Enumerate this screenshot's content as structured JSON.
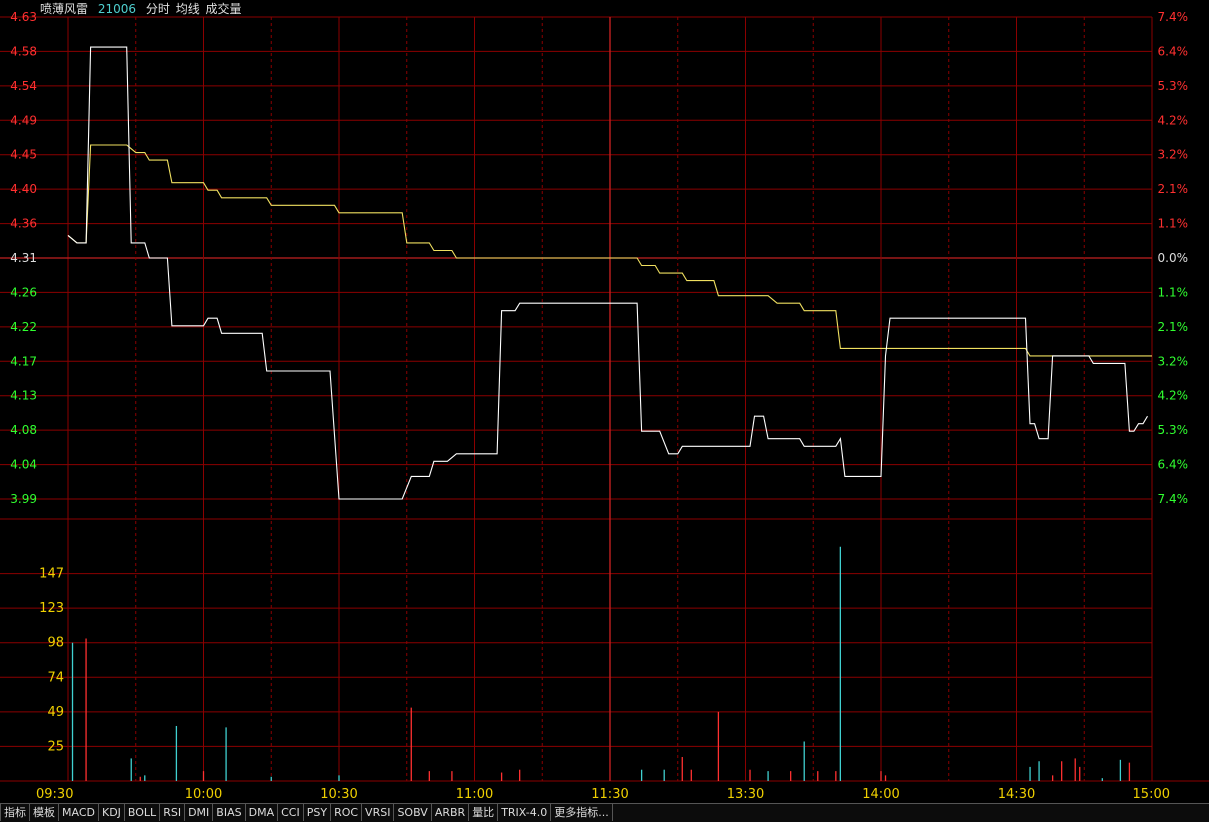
{
  "header": {
    "stock_name": "喷薄风雷",
    "stock_code": "21006",
    "items": [
      "分时",
      "均线",
      "成交量"
    ]
  },
  "tabs": [
    "指标",
    "模板",
    "MACD",
    "KDJ",
    "BOLL",
    "RSI",
    "DMI",
    "BIAS",
    "DMA",
    "CCI",
    "PSY",
    "ROC",
    "VRSI",
    "SOBV",
    "ARBR",
    "量比",
    "TRIX-4.0",
    "更多指标..."
  ],
  "colors": {
    "grid": "#8b0000",
    "up": "#ff3030",
    "down": "#30ff30",
    "price_line": "#ffffff",
    "avg_line": "#f0e060",
    "vol_up": "#ff3030",
    "vol_down": "#40d0d0",
    "vol_axis": "#f0d000"
  },
  "chart_data": {
    "type": "line",
    "title": "",
    "prev_close": 4.31,
    "price_ticks": [
      "4.63",
      "4.58",
      "4.54",
      "4.49",
      "4.45",
      "4.40",
      "4.36",
      "4.31",
      "4.26",
      "4.22",
      "4.17",
      "4.13",
      "4.08",
      "4.04",
      "3.99"
    ],
    "pct_ticks": [
      "7.4%",
      "6.4%",
      "5.3%",
      "4.2%",
      "3.2%",
      "2.1%",
      "1.1%",
      "0.0%",
      "1.1%",
      "2.1%",
      "3.2%",
      "4.2%",
      "5.3%",
      "6.4%",
      "7.4%"
    ],
    "volume_ticks": [
      "147",
      "123",
      "98",
      "74",
      "49",
      "25"
    ],
    "ylim_price": [
      3.99,
      4.63
    ],
    "ylim_volume": [
      0,
      171.5
    ],
    "time_labels": [
      "09:30",
      "10:00",
      "10:30",
      "11:00",
      "11:30",
      "13:30",
      "14:00",
      "14:30",
      "15:00"
    ],
    "session_minutes": 240,
    "series": [
      {
        "name": "",
        "points": [
          [
            0,
            4.34
          ],
          [
            2,
            4.33
          ],
          [
            4,
            4.33
          ],
          [
            5,
            4.59
          ],
          [
            13,
            4.59
          ],
          [
            14,
            4.33
          ],
          [
            17,
            4.33
          ],
          [
            18,
            4.31
          ],
          [
            22,
            4.31
          ],
          [
            23,
            4.22
          ],
          [
            30,
            4.22
          ],
          [
            31,
            4.23
          ],
          [
            33,
            4.23
          ],
          [
            34,
            4.21
          ],
          [
            43,
            4.21
          ],
          [
            44,
            4.16
          ],
          [
            58,
            4.16
          ],
          [
            60,
            3.99
          ],
          [
            74,
            3.99
          ],
          [
            76,
            4.02
          ],
          [
            80,
            4.02
          ],
          [
            81,
            4.04
          ],
          [
            84,
            4.04
          ],
          [
            86,
            4.05
          ],
          [
            95,
            4.05
          ],
          [
            96,
            4.24
          ],
          [
            99,
            4.24
          ],
          [
            100,
            4.25
          ],
          [
            126,
            4.25
          ],
          [
            127,
            4.08
          ],
          [
            131,
            4.08
          ],
          [
            133,
            4.05
          ],
          [
            135,
            4.05
          ],
          [
            136,
            4.06
          ],
          [
            151,
            4.06
          ],
          [
            152,
            4.1
          ],
          [
            154,
            4.1
          ],
          [
            155,
            4.07
          ],
          [
            162,
            4.07
          ],
          [
            163,
            4.06
          ],
          [
            170,
            4.06
          ],
          [
            171,
            4.07
          ],
          [
            172,
            4.02
          ],
          [
            180,
            4.02
          ],
          [
            181,
            4.18
          ],
          [
            182,
            4.23
          ],
          [
            212,
            4.23
          ],
          [
            213,
            4.09
          ],
          [
            214,
            4.09
          ],
          [
            215,
            4.07
          ],
          [
            217,
            4.07
          ],
          [
            218,
            4.18
          ],
          [
            226,
            4.18
          ],
          [
            227,
            4.17
          ],
          [
            234,
            4.17
          ],
          [
            235,
            4.08
          ],
          [
            236,
            4.08
          ],
          [
            237,
            4.09
          ],
          [
            238,
            4.09
          ],
          [
            239,
            4.1
          ]
        ]
      },
      {
        "name": "",
        "points": [
          [
            0,
            4.34
          ],
          [
            2,
            4.33
          ],
          [
            4,
            4.33
          ],
          [
            5,
            4.46
          ],
          [
            13,
            4.46
          ],
          [
            15,
            4.45
          ],
          [
            17,
            4.45
          ],
          [
            18,
            4.44
          ],
          [
            22,
            4.44
          ],
          [
            23,
            4.41
          ],
          [
            30,
            4.41
          ],
          [
            31,
            4.4
          ],
          [
            33,
            4.4
          ],
          [
            34,
            4.39
          ],
          [
            44,
            4.39
          ],
          [
            45,
            4.38
          ],
          [
            59,
            4.38
          ],
          [
            60,
            4.37
          ],
          [
            74,
            4.37
          ],
          [
            75,
            4.33
          ],
          [
            80,
            4.33
          ],
          [
            81,
            4.32
          ],
          [
            85,
            4.32
          ],
          [
            86,
            4.31
          ],
          [
            126,
            4.31
          ],
          [
            127,
            4.3
          ],
          [
            130,
            4.3
          ],
          [
            131,
            4.29
          ],
          [
            136,
            4.29
          ],
          [
            137,
            4.28
          ],
          [
            143,
            4.28
          ],
          [
            144,
            4.26
          ],
          [
            155,
            4.26
          ],
          [
            157,
            4.25
          ],
          [
            162,
            4.25
          ],
          [
            163,
            4.24
          ],
          [
            170,
            4.24
          ],
          [
            171,
            4.19
          ],
          [
            212,
            4.19
          ],
          [
            213,
            4.18
          ],
          [
            236,
            4.18
          ],
          [
            240,
            4.18
          ]
        ]
      }
    ],
    "volume_bars": [
      [
        1,
        98,
        "down"
      ],
      [
        4,
        101,
        "up"
      ],
      [
        14,
        16,
        "down"
      ],
      [
        16,
        3,
        "up"
      ],
      [
        17,
        4,
        "down"
      ],
      [
        24,
        39,
        "down"
      ],
      [
        30,
        7,
        "up"
      ],
      [
        35,
        38,
        "down"
      ],
      [
        45,
        3,
        "down"
      ],
      [
        60,
        4,
        "down"
      ],
      [
        76,
        52,
        "up"
      ],
      [
        80,
        7,
        "up"
      ],
      [
        85,
        7,
        "up"
      ],
      [
        96,
        6,
        "up"
      ],
      [
        100,
        8,
        "up"
      ],
      [
        127,
        8,
        "down"
      ],
      [
        132,
        8,
        "down"
      ],
      [
        136,
        17,
        "up"
      ],
      [
        138,
        8,
        "up"
      ],
      [
        144,
        49,
        "up"
      ],
      [
        151,
        8,
        "up"
      ],
      [
        155,
        7,
        "down"
      ],
      [
        160,
        7,
        "up"
      ],
      [
        163,
        28,
        "down"
      ],
      [
        166,
        7,
        "up"
      ],
      [
        170,
        7,
        "up"
      ],
      [
        171,
        166,
        "down"
      ],
      [
        180,
        7,
        "up"
      ],
      [
        181,
        4,
        "up"
      ],
      [
        213,
        10,
        "down"
      ],
      [
        215,
        14,
        "down"
      ],
      [
        218,
        4,
        "up"
      ],
      [
        220,
        14,
        "up"
      ],
      [
        223,
        16,
        "up"
      ],
      [
        224,
        10,
        "up"
      ],
      [
        229,
        2,
        "down"
      ],
      [
        233,
        15,
        "down"
      ],
      [
        235,
        13,
        "up"
      ]
    ]
  }
}
